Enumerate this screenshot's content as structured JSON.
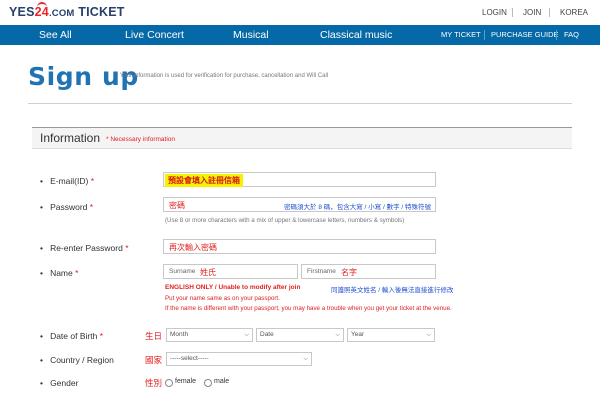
{
  "header": {
    "logo_yes": "YES",
    "logo_24": "24",
    "logo_com": ".COM",
    "logo_ticket": "TICKET",
    "util_links": [
      "LOGIN",
      "JOIN",
      "KOREA"
    ]
  },
  "nav": {
    "items": [
      "See All",
      "Live Concert",
      "Musical",
      "Classical music"
    ],
    "right_items": [
      "MY TICKET",
      "PURCHASE GUIDE",
      "FAQ"
    ]
  },
  "page": {
    "title": "Sign up",
    "title_note": "* Your information is used for verification for purchase, cancellation and Will Call"
  },
  "section": {
    "title": "Information",
    "note": "* Necessary information"
  },
  "form": {
    "email": {
      "label": "E-mail(ID)",
      "req": "*",
      "value": "預設會填入註冊信箱"
    },
    "password": {
      "label": "Password",
      "req": "*",
      "value": "密碼",
      "hint_zh": "密碼須大於 8 碼，包含大寫 / 小寫 / 數字 / 特殊符號",
      "hint": "(Use 8 or more characters with a mix of upper & lowercase letters, numbers & symbols)"
    },
    "reenter": {
      "label": "Re-enter Password",
      "req": "*",
      "value": "再次輸入密碼"
    },
    "name": {
      "label": "Name",
      "req": "*",
      "surname_ph": "Surname",
      "surname_zh": "姓氏",
      "firstname_ph": "Firstname",
      "firstname_zh": "名字",
      "english_only": "ENGLISH ONLY / Unable to modify after join",
      "english_only_zh": "同護照英文姓名 / 輸入後無法直接進行修改",
      "note1": "Put your name same as on your passport.",
      "note2": "If the name is different with your passport, you may have a trouble when you get your ticket at the venue."
    },
    "dob": {
      "label": "Date of Birth",
      "req": "*",
      "zh": "生日",
      "month": "Month",
      "date": "Date",
      "year": "Year"
    },
    "country": {
      "label": "Country / Region",
      "zh": "國家",
      "select": "-----select-----"
    },
    "gender": {
      "label": "Gender",
      "zh": "性別",
      "female": "female",
      "male": "male"
    }
  },
  "colors": {
    "brand_blue": "#0569a8",
    "title_blue": "#2174b4",
    "required_red": "#e02020",
    "highlight": "#f7f300"
  }
}
